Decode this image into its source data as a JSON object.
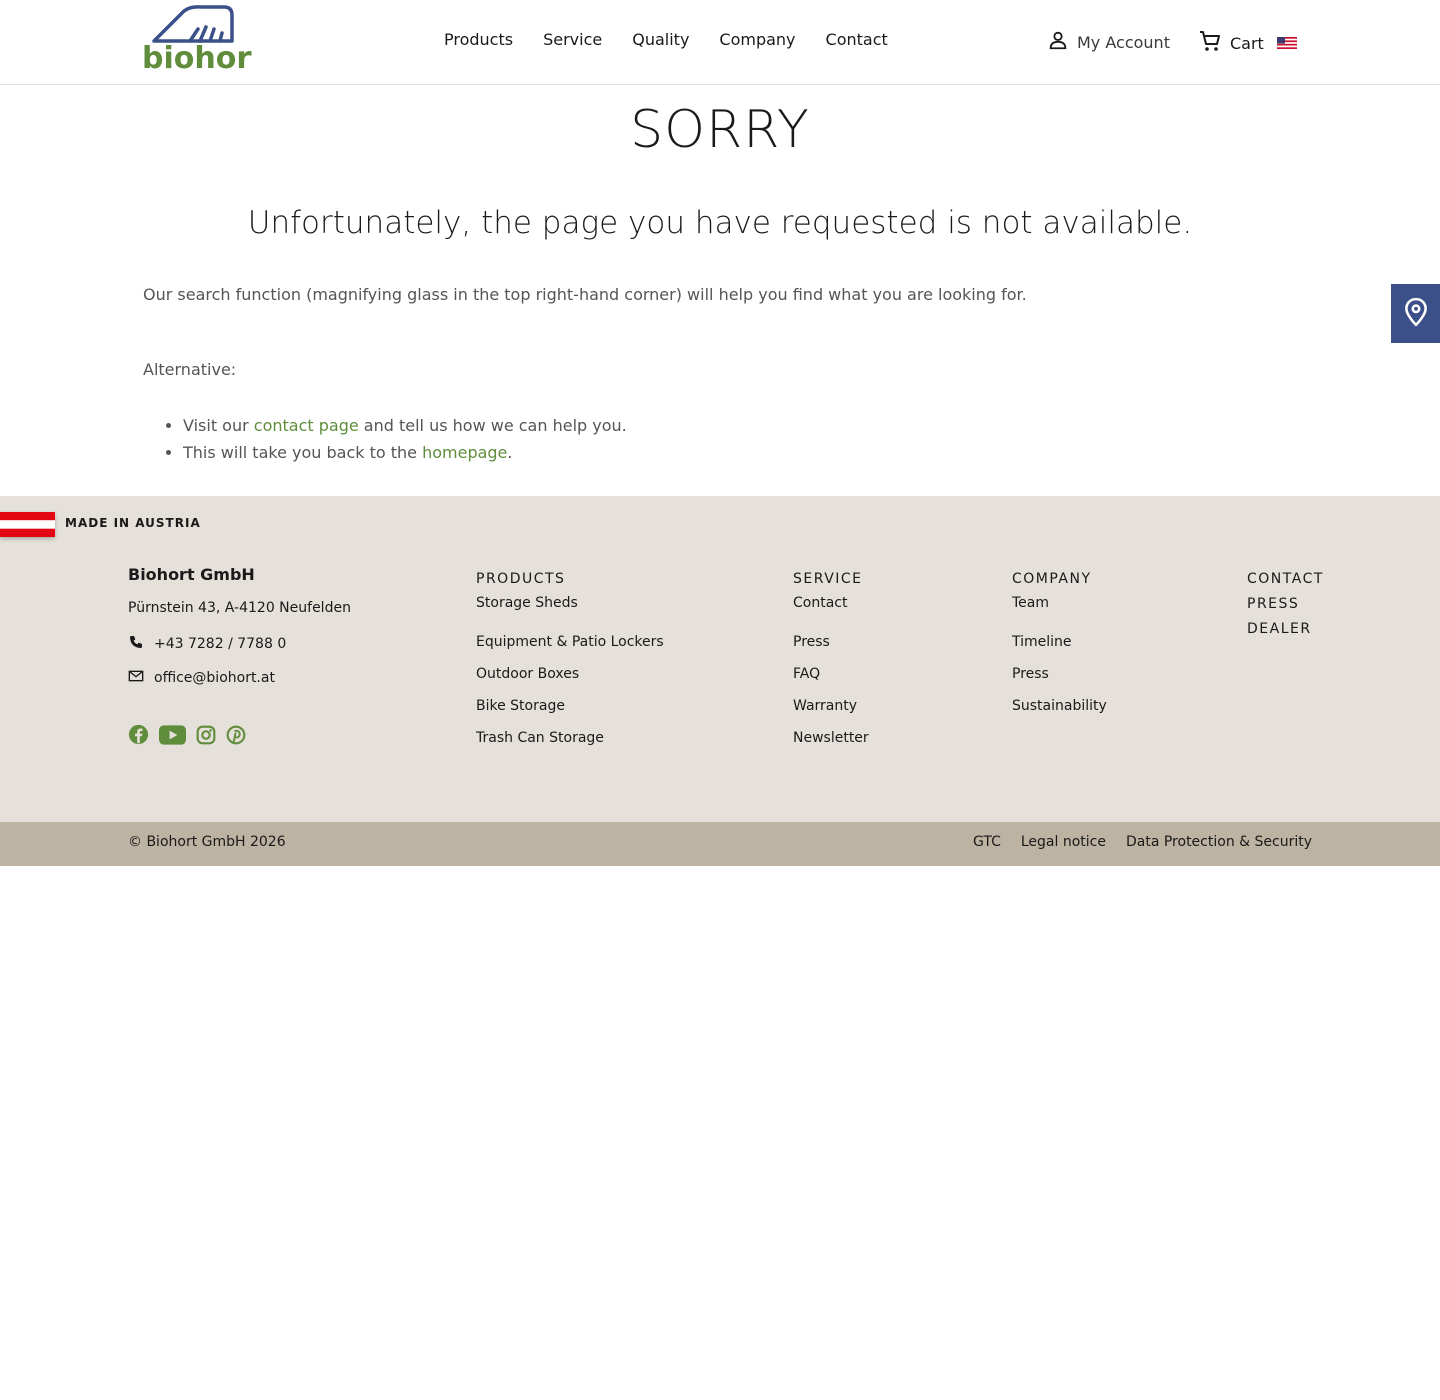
{
  "header": {
    "logo_text": "biohort",
    "nav": [
      "Products",
      "Service",
      "Quality",
      "Company",
      "Contact"
    ],
    "account_label": "My Account",
    "cart_label": "Cart",
    "language_flag": "us-flag-icon"
  },
  "main": {
    "title": "SORRY",
    "subtitle": "Unfortunately, the page you have requested is not available.",
    "search_hint": "Our search function (magnifying glass in the top right-hand corner) will help you find what you are looking for.",
    "alternative_label": "Alternative:",
    "items": [
      {
        "prefix": "Visit our ",
        "link": "contact page",
        "suffix": " and tell us how we can help you."
      },
      {
        "prefix": "This will take you back to the ",
        "link": "homepage",
        "suffix": "."
      }
    ]
  },
  "footer": {
    "made_in": "MADE IN AUSTRIA",
    "company": "Biohort GmbH",
    "address": "Pürnstein 43, A-4120 Neufelden",
    "phone": "+43 7282 / 7788 0",
    "email": "office@biohort.at",
    "columns": [
      {
        "title": "PRODUCTS",
        "links": [
          "Storage Sheds",
          "Equipment & Patio Lockers",
          "Outdoor Boxes",
          "Bike Storage",
          "Trash Can Storage"
        ]
      },
      {
        "title": "SERVICE",
        "links": [
          "Contact",
          "Press",
          "FAQ",
          "Warranty",
          "Newsletter"
        ]
      },
      {
        "title": "COMPANY",
        "links": [
          "Team",
          "Timeline",
          "Press",
          "Sustainability"
        ]
      }
    ],
    "contact_links": [
      "CONTACT",
      "PRESS",
      "DEALER"
    ],
    "copyright": "© Biohort GmbH 2026",
    "legal": [
      "GTC",
      "Legal notice",
      "Data Protection & Security"
    ]
  },
  "colors": {
    "brand_green": "#5f8d3b",
    "brand_blue": "#3b5088",
    "footer_bg": "#e5e0da",
    "bottom_bar": "#bdb3a2"
  }
}
